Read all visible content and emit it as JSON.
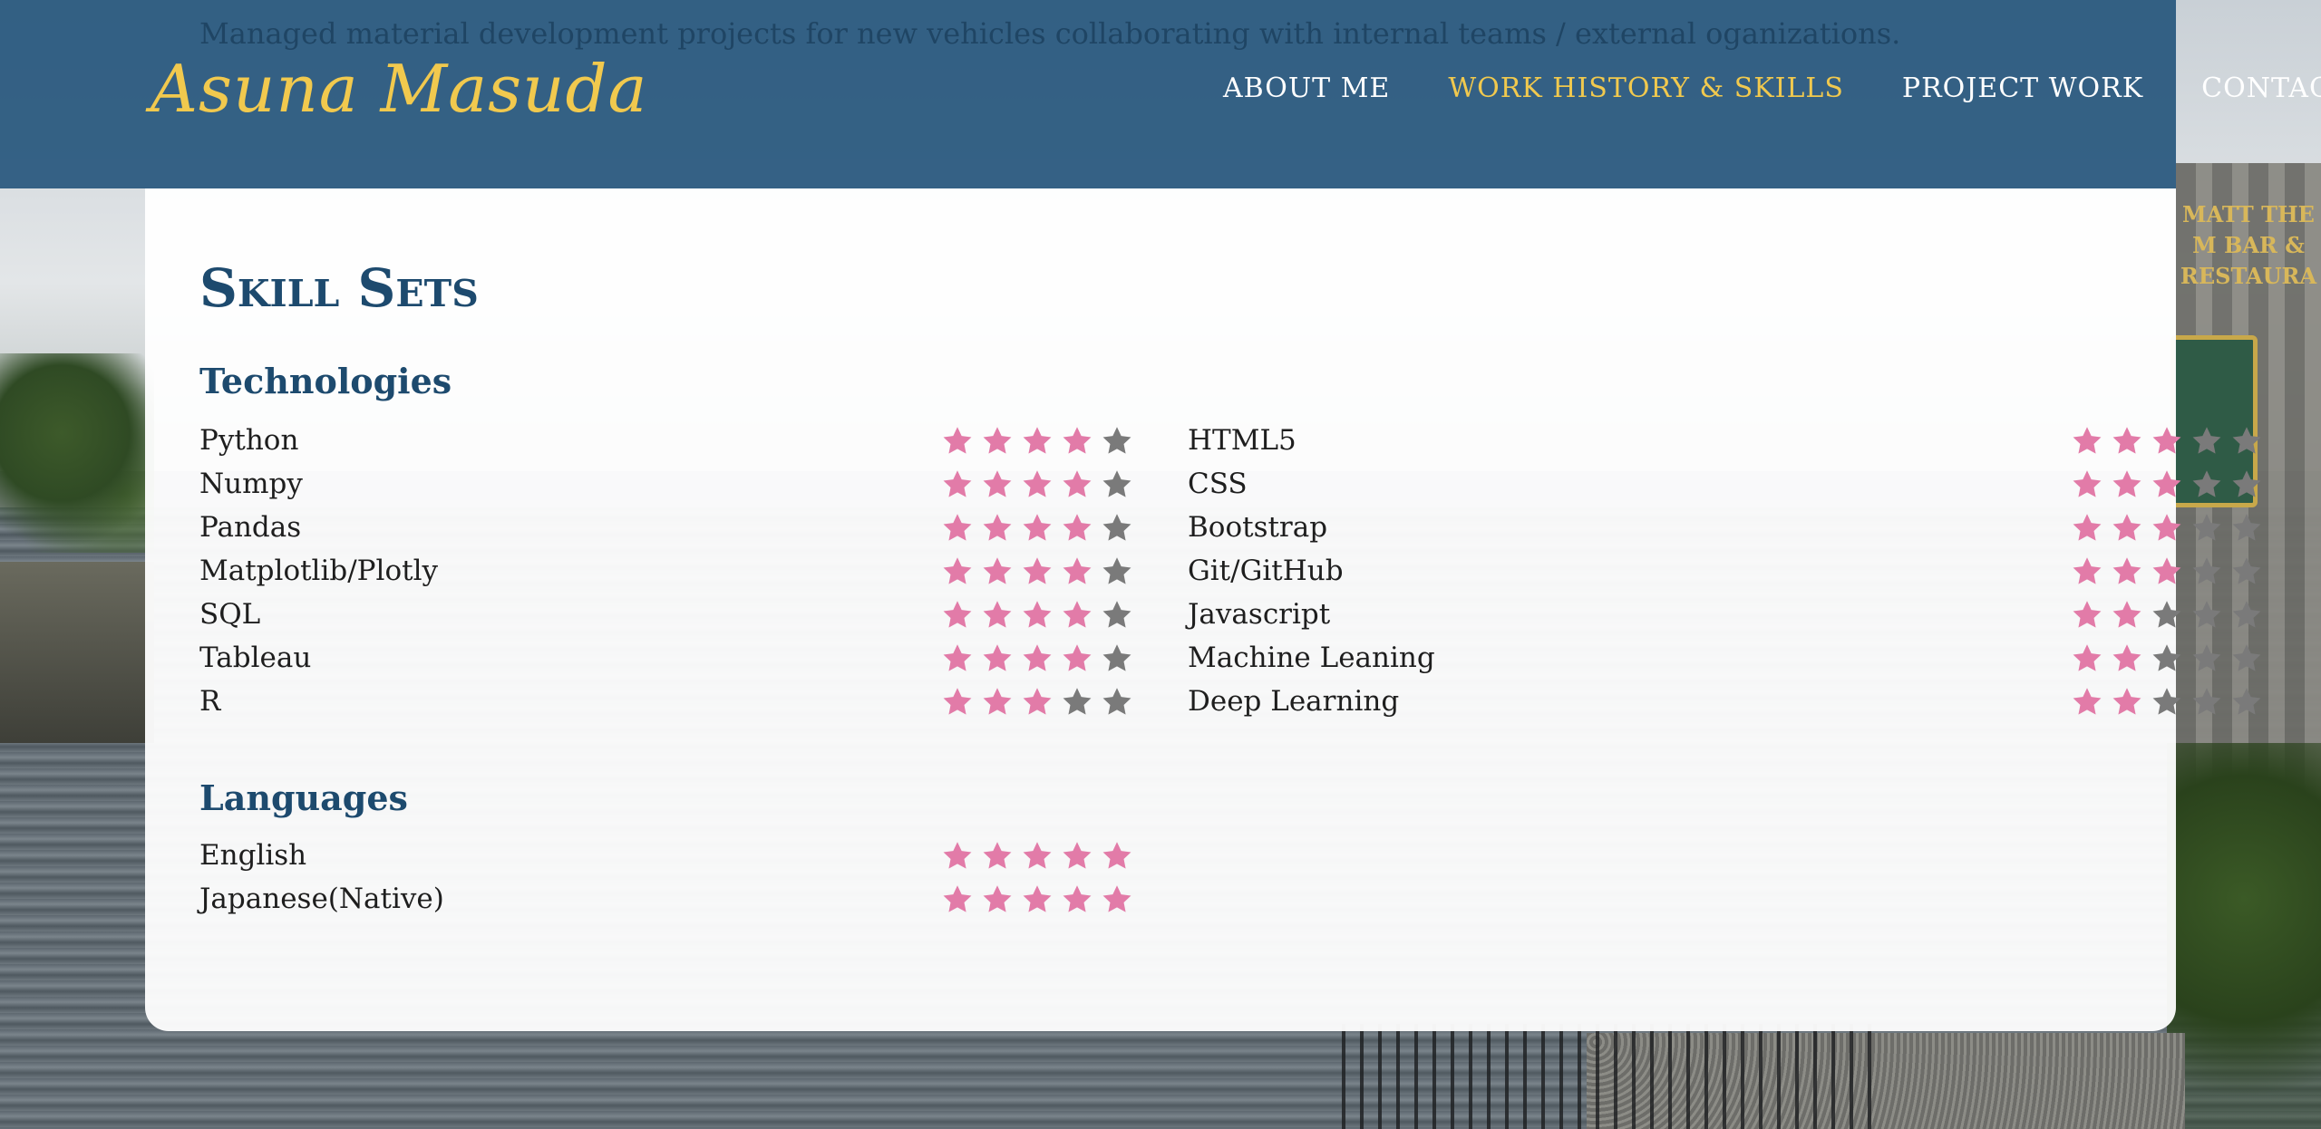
{
  "header": {
    "subtitle": "Managed material development projects for new vehicles collaborating with internal teams / external oganizations.",
    "logo": "Asuna Masuda",
    "nav": [
      {
        "label": "ABOUT ME",
        "active": false
      },
      {
        "label": "WORK HISTORY & SKILLS",
        "active": true
      },
      {
        "label": "PROJECT WORK",
        "active": false
      },
      {
        "label": "CONTACT",
        "active": false
      }
    ]
  },
  "background": {
    "sign_text": "MATT THE M BAR & RESTAURA"
  },
  "skills": {
    "title": "Skill Sets",
    "technologies_heading": "Technologies",
    "technologies_left": [
      {
        "name": "Python",
        "rating": 4
      },
      {
        "name": "Numpy",
        "rating": 4
      },
      {
        "name": "Pandas",
        "rating": 4
      },
      {
        "name": "Matplotlib/Plotly",
        "rating": 4
      },
      {
        "name": "SQL",
        "rating": 4
      },
      {
        "name": "Tableau",
        "rating": 4
      },
      {
        "name": "R",
        "rating": 3
      }
    ],
    "technologies_right": [
      {
        "name": "HTML5",
        "rating": 3
      },
      {
        "name": "CSS",
        "rating": 3
      },
      {
        "name": "Bootstrap",
        "rating": 3
      },
      {
        "name": "Git/GitHub",
        "rating": 3
      },
      {
        "name": "Javascript",
        "rating": 2
      },
      {
        "name": "Machine Leaning",
        "rating": 2
      },
      {
        "name": "Deep Learning",
        "rating": 2
      }
    ],
    "languages_heading": "Languages",
    "languages": [
      {
        "name": "English",
        "rating": 5
      },
      {
        "name": "Japanese(Native)",
        "rating": 5
      }
    ],
    "max_rating": 5
  },
  "colors": {
    "header_bg": "#1e5078",
    "accent": "#f1c94e",
    "star_filled": "#e27ba8",
    "star_empty": "#7a7a7a",
    "heading": "#1d4a6e"
  },
  "icons": {
    "star": "star-icon"
  }
}
